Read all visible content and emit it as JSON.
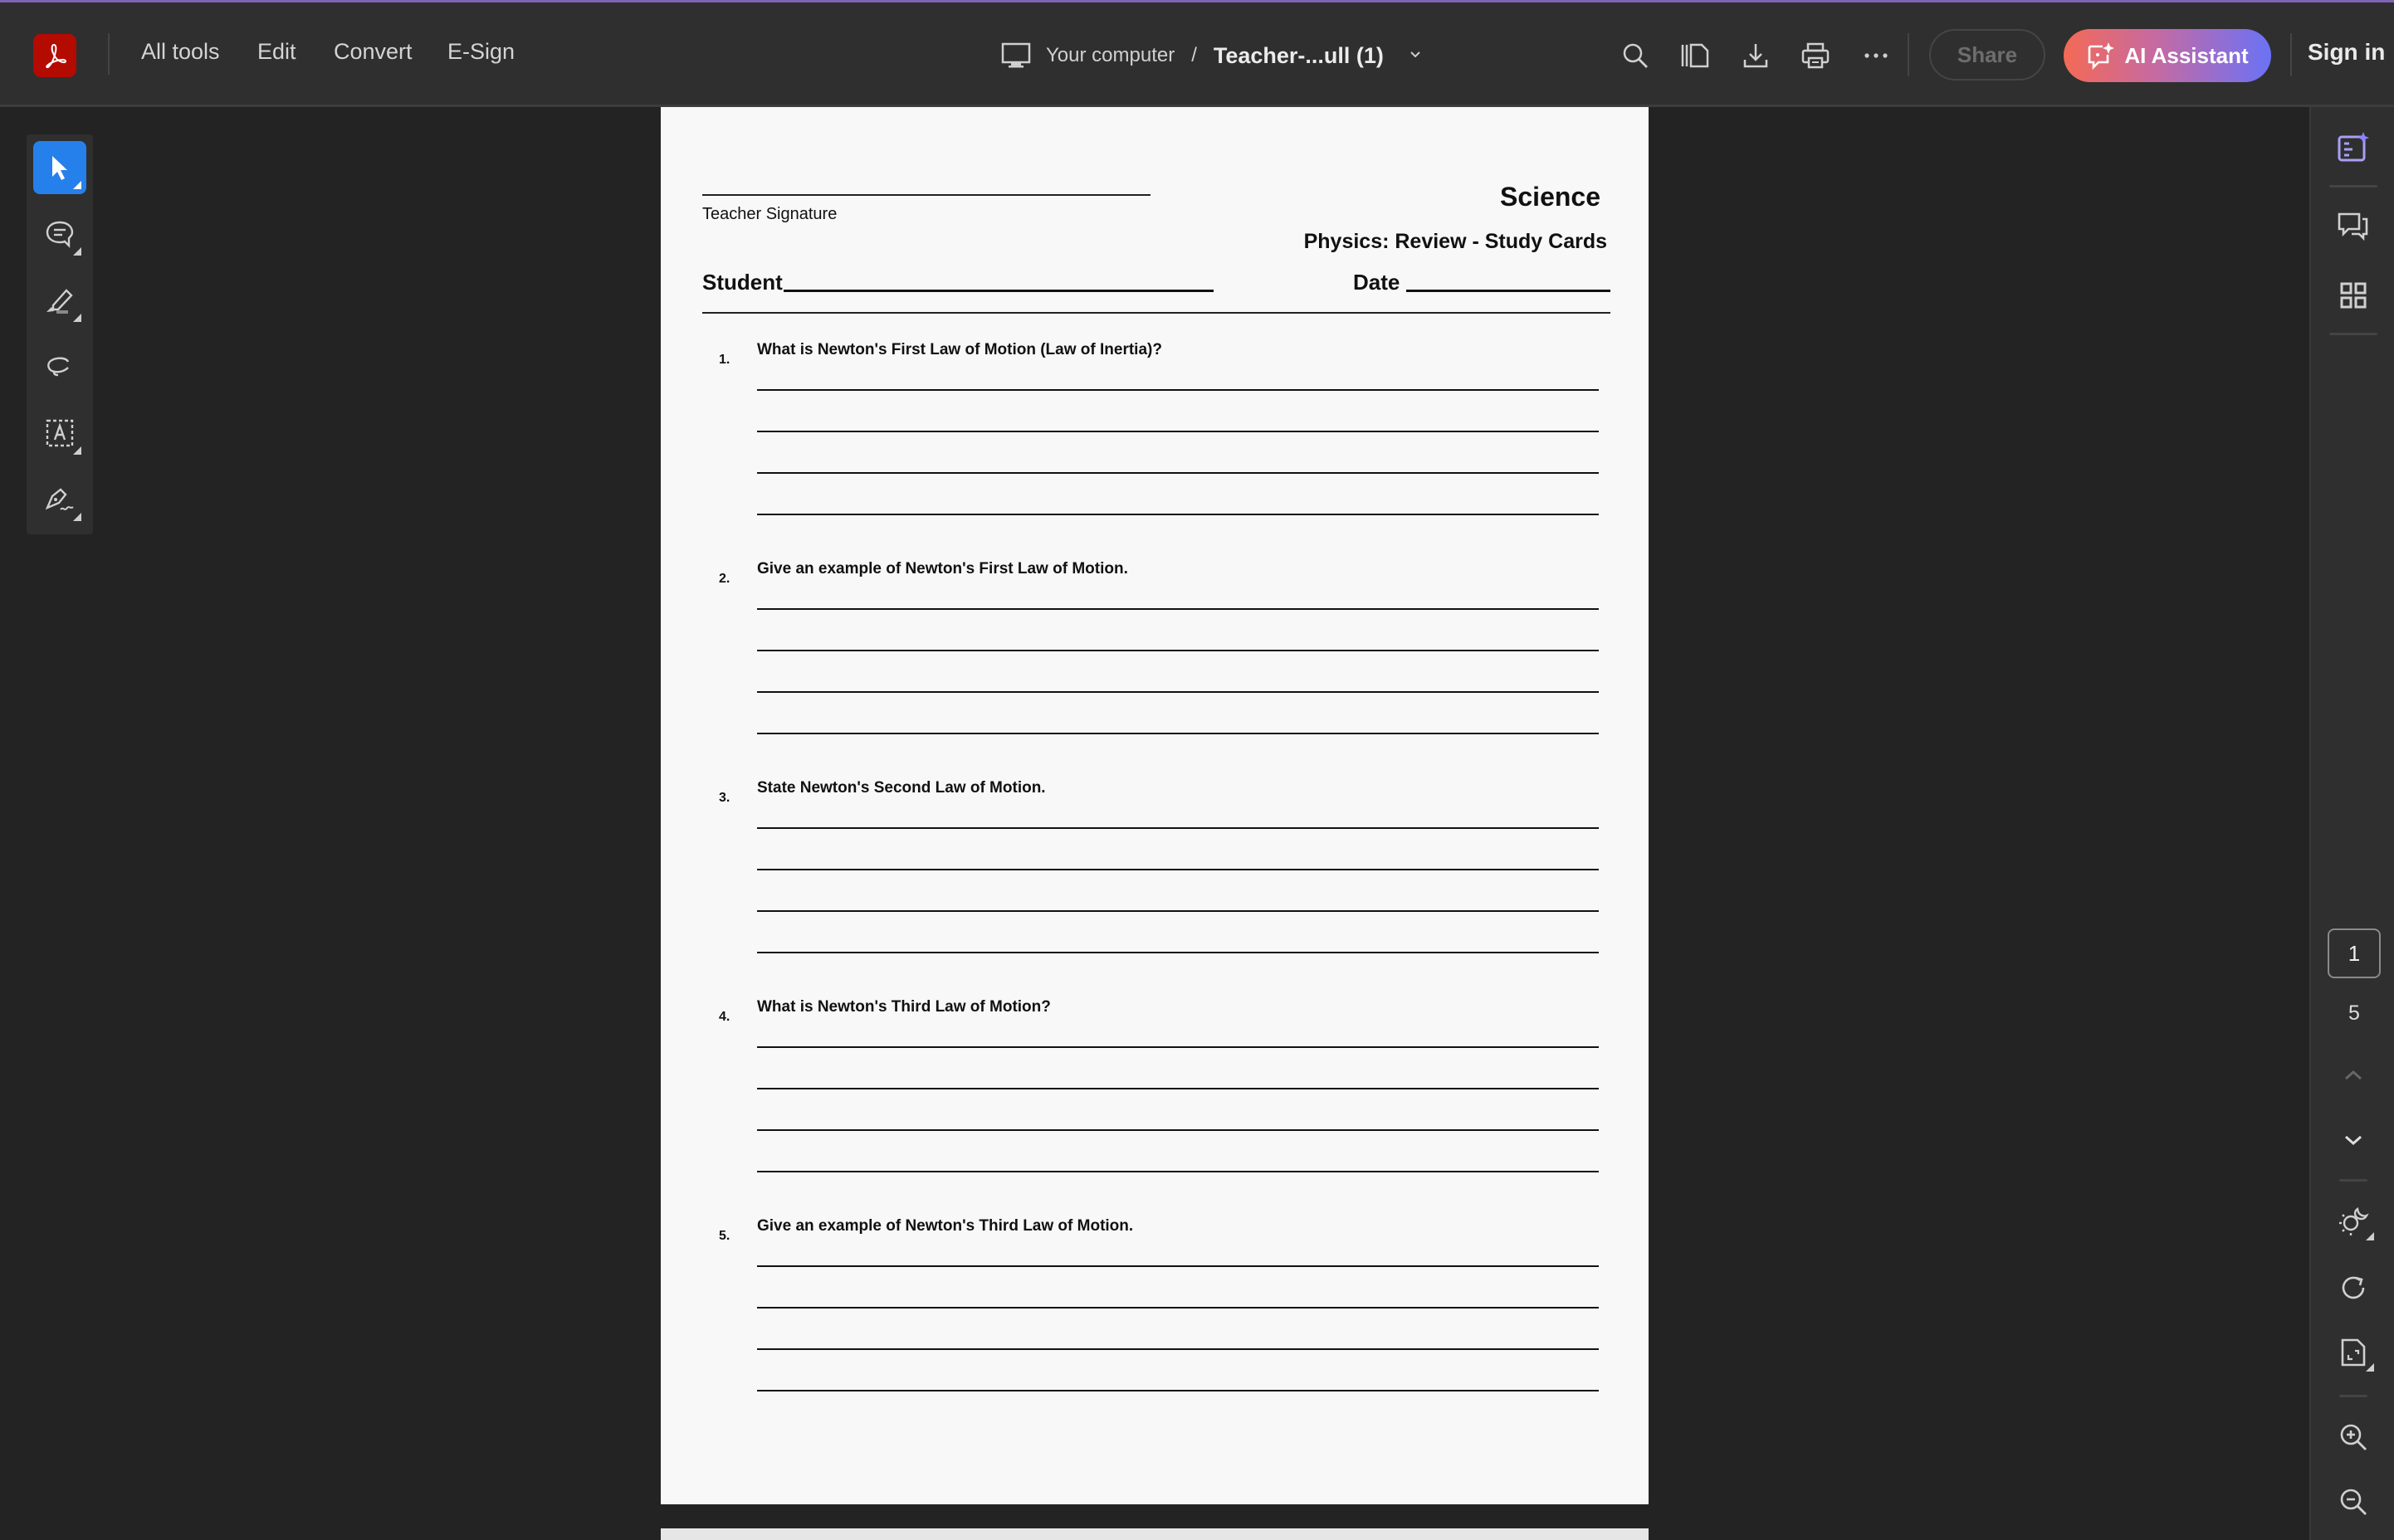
{
  "header": {
    "nav": [
      "All tools",
      "Edit",
      "Convert",
      "E-Sign"
    ],
    "breadcrumb": {
      "source": "Your computer",
      "separator": "/",
      "file": "Teacher-...ull (1)"
    },
    "share_label": "Share",
    "ai_label": "AI Assistant",
    "signin_label": "Sign in",
    "accent_color": "#7d64b6",
    "logo_color": "#b30b00"
  },
  "left_tools": [
    {
      "name": "select",
      "active": true
    },
    {
      "name": "comment"
    },
    {
      "name": "highlight"
    },
    {
      "name": "draw"
    },
    {
      "name": "text-select"
    },
    {
      "name": "sign"
    }
  ],
  "right_rail": {
    "current_page": "1",
    "total_pages": "5"
  },
  "document": {
    "teacher_signature_label": "Teacher Signature",
    "subject": "Science",
    "subtitle": "Physics: Review - Study Cards",
    "student_label": "Student",
    "date_label": "Date",
    "questions": [
      {
        "num": "1.",
        "text": "What is Newton's First Law of Motion (Law of Inertia)?"
      },
      {
        "num": "2.",
        "text": "Give an example of Newton's First Law of Motion."
      },
      {
        "num": "3.",
        "text": "State Newton's Second Law of Motion."
      },
      {
        "num": "4.",
        "text": "What is Newton's Third Law of Motion?"
      },
      {
        "num": "5.",
        "text": "Give an example of Newton's Third Law of Motion."
      }
    ]
  }
}
